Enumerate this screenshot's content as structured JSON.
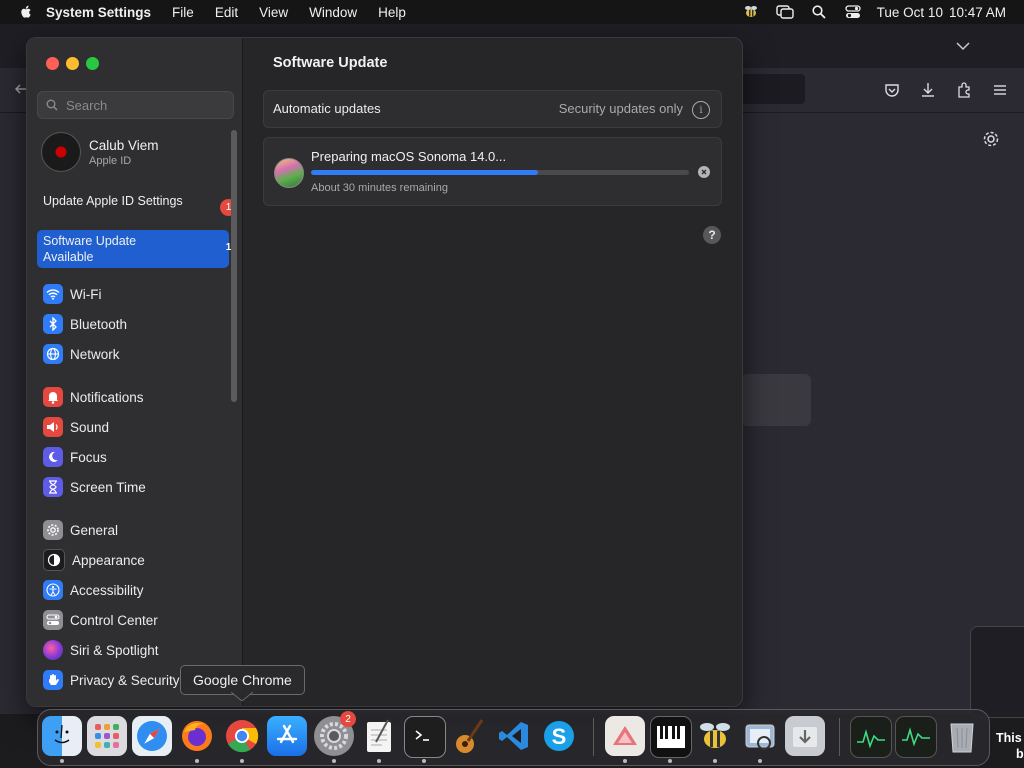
{
  "menubar": {
    "app": "System Settings",
    "menus": [
      "File",
      "Edit",
      "View",
      "Window",
      "Help"
    ],
    "date": "Tue Oct 10",
    "time": "10:47 AM"
  },
  "sidebar": {
    "search_placeholder": "Search",
    "account": {
      "name": "Calub Viem",
      "subtitle": "Apple ID"
    },
    "notices": [
      {
        "label": "Update Apple ID Settings",
        "badge": "1"
      },
      {
        "label": "Software Update Available",
        "badge": "1"
      }
    ],
    "items": [
      {
        "label": "Wi-Fi",
        "icon": "wifi-icon",
        "color": "#2f7cf6"
      },
      {
        "label": "Bluetooth",
        "icon": "bluetooth-icon",
        "color": "#2f7cf6"
      },
      {
        "label": "Network",
        "icon": "globe-icon",
        "color": "#2f7cf6"
      },
      {
        "label": "Notifications",
        "icon": "bell-icon",
        "color": "#e5483f"
      },
      {
        "label": "Sound",
        "icon": "speaker-icon",
        "color": "#e5483f"
      },
      {
        "label": "Focus",
        "icon": "moon-icon",
        "color": "#5e5ce6"
      },
      {
        "label": "Screen Time",
        "icon": "hourglass-icon",
        "color": "#5e5ce6"
      },
      {
        "label": "General",
        "icon": "gear-icon",
        "color": "#8e8e93"
      },
      {
        "label": "Appearance",
        "icon": "appearance-icon",
        "color": "#1c1c1e"
      },
      {
        "label": "Accessibility",
        "icon": "accessibility-icon",
        "color": "#2f7cf6"
      },
      {
        "label": "Control Center",
        "icon": "control-center-icon",
        "color": "#8e8e93"
      },
      {
        "label": "Siri & Spotlight",
        "icon": "siri-icon",
        "color": "#b63bd6"
      },
      {
        "label": "Privacy & Security",
        "icon": "hand-icon",
        "color": "#2f7cf6"
      }
    ]
  },
  "main": {
    "title": "Software Update",
    "automatic": {
      "label": "Automatic updates",
      "value": "Security updates only"
    },
    "update": {
      "title": "Preparing macOS Sonoma 14.0...",
      "status": "About 30 minutes remaining",
      "progress": 0.6
    }
  },
  "tooltip": "Google Chrome",
  "dock": {
    "apps": [
      "Finder",
      "Launchpad",
      "Safari",
      "Firefox",
      "Google Chrome",
      "App Store",
      "System Settings",
      "TextEdit",
      "Terminal",
      "GarageBand",
      "Visual Studio Code",
      "Skype",
      "Affinity",
      "Piano",
      "Cyberduck",
      "Preview",
      "Downloads",
      "Activity Monitor",
      "Activity Monitor",
      "Trash"
    ],
    "settings_badge": "2"
  },
  "edge_text": [
    "This",
    "b"
  ]
}
